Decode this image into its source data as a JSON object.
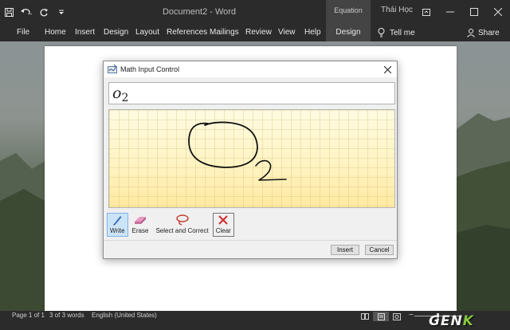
{
  "window": {
    "document_title": "Document2  -  Word",
    "contextual_group": "Equation Tools",
    "user_name": "Thái Học"
  },
  "ribbon": {
    "tabs": [
      {
        "label": "File"
      },
      {
        "label": "Home"
      },
      {
        "label": "Insert"
      },
      {
        "label": "Design"
      },
      {
        "label": "Layout"
      },
      {
        "label": "References"
      },
      {
        "label": "Mailings"
      },
      {
        "label": "Review"
      },
      {
        "label": "View"
      },
      {
        "label": "Help"
      },
      {
        "label": "Design"
      }
    ],
    "tell_me": "Tell me",
    "share": "Share"
  },
  "dialog": {
    "title": "Math Input Control",
    "preview_base": "o",
    "preview_sub": "2",
    "tools": [
      {
        "label": "Write",
        "icon": "pen-icon",
        "selected": true
      },
      {
        "label": "Erase",
        "icon": "eraser-icon",
        "selected": false
      },
      {
        "label": "Select and Correct",
        "icon": "lasso-icon",
        "selected": false
      },
      {
        "label": "Clear",
        "icon": "clear-icon",
        "selected": false
      }
    ],
    "insert_label": "Insert",
    "cancel_label": "Cancel"
  },
  "status": {
    "page": "Page 1 of 1",
    "words": "3 of 3 words",
    "language": "English (United States)"
  },
  "watermark": {
    "main": "GEN",
    "accent": "K"
  },
  "colors": {
    "chrome": "#2b2b2b",
    "canvas": "#fff6c6",
    "ink": "#111111",
    "selected_tool": "#cce4f7"
  }
}
